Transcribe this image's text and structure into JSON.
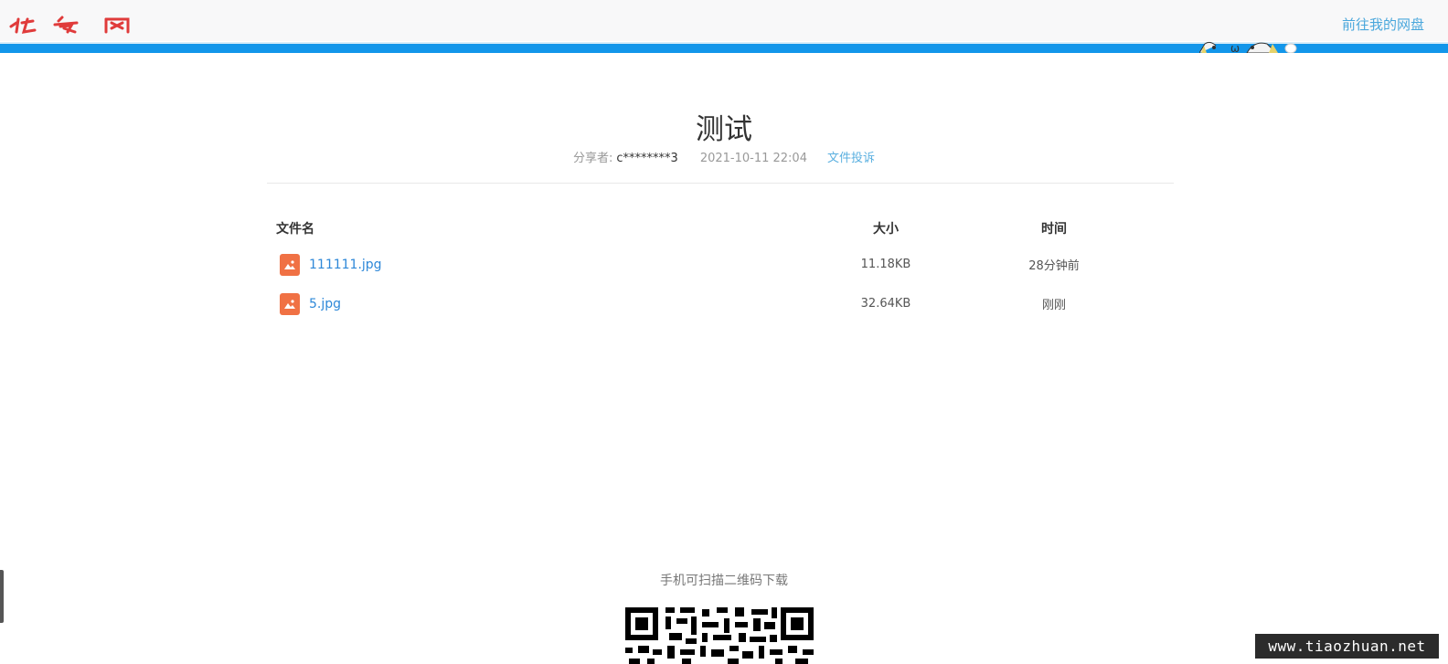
{
  "header": {
    "nav_link": "前往我的网盘"
  },
  "share": {
    "title": "测试",
    "sharer_label": "分享者:",
    "sharer_name": "c********3",
    "date": "2021-10-11 22:04",
    "report_link": "文件投诉"
  },
  "table": {
    "columns": {
      "name": "文件名",
      "size": "大小",
      "time": "时间"
    },
    "rows": [
      {
        "name": "111111.jpg",
        "size": "11.18KB",
        "time": "28分钟前",
        "icon": "image-file-icon"
      },
      {
        "name": "5.jpg",
        "size": "32.64KB",
        "time": "刚刚",
        "icon": "image-file-icon"
      }
    ]
  },
  "qr": {
    "caption": "手机可扫描二维码下载"
  },
  "watermark": "www.tiaozhuan.net",
  "colors": {
    "accent_blue": "#1296ea",
    "link_blue": "#2e88d8",
    "file_icon_orange": "#f07144",
    "logo_red": "#e03b3b"
  }
}
